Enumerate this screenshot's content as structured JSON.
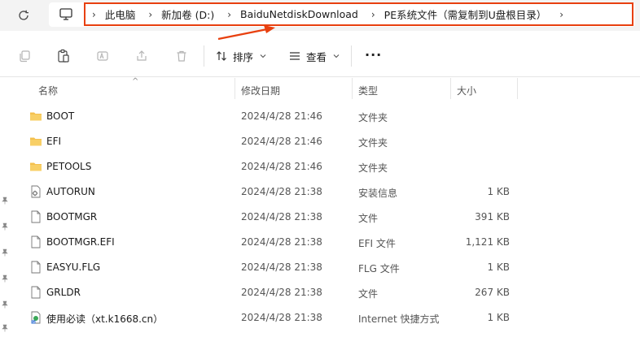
{
  "address_bar": {
    "crumbs": [
      "此电脑",
      "新加卷 (D:)",
      "BaiduNetdiskDownload",
      "PE系统文件（需复制到U盘根目录）"
    ]
  },
  "toolbar": {
    "sort_label": "排序",
    "view_label": "查看",
    "more_label": "···"
  },
  "columns": {
    "name": "名称",
    "date": "修改日期",
    "type": "类型",
    "size": "大小"
  },
  "files": [
    {
      "name": "BOOT",
      "date": "2024/4/28 21:46",
      "type": "文件夹",
      "size": "",
      "icon": "folder-icon"
    },
    {
      "name": "EFI",
      "date": "2024/4/28 21:46",
      "type": "文件夹",
      "size": "",
      "icon": "folder-icon"
    },
    {
      "name": "PETOOLS",
      "date": "2024/4/28 21:46",
      "type": "文件夹",
      "size": "",
      "icon": "folder-icon"
    },
    {
      "name": "AUTORUN",
      "date": "2024/4/28 21:38",
      "type": "安装信息",
      "size": "1 KB",
      "icon": "settings-file-icon"
    },
    {
      "name": "BOOTMGR",
      "date": "2024/4/28 21:38",
      "type": "文件",
      "size": "391 KB",
      "icon": "file-icon"
    },
    {
      "name": "BOOTMGR.EFI",
      "date": "2024/4/28 21:38",
      "type": "EFI 文件",
      "size": "1,121 KB",
      "icon": "file-icon"
    },
    {
      "name": "EASYU.FLG",
      "date": "2024/4/28 21:38",
      "type": "FLG 文件",
      "size": "1 KB",
      "icon": "file-icon"
    },
    {
      "name": "GRLDR",
      "date": "2024/4/28 21:38",
      "type": "文件",
      "size": "267 KB",
      "icon": "file-icon"
    },
    {
      "name": "使用必读（xt.k1668.cn）",
      "date": "2024/4/28 21:38",
      "type": "Internet 快捷方式",
      "size": "1 KB",
      "icon": "internet-shortcut-icon"
    }
  ],
  "colors": {
    "highlight_border": "#e8400f",
    "folder": "#f4c04e",
    "topbar_bg": "#f3f3f3"
  }
}
